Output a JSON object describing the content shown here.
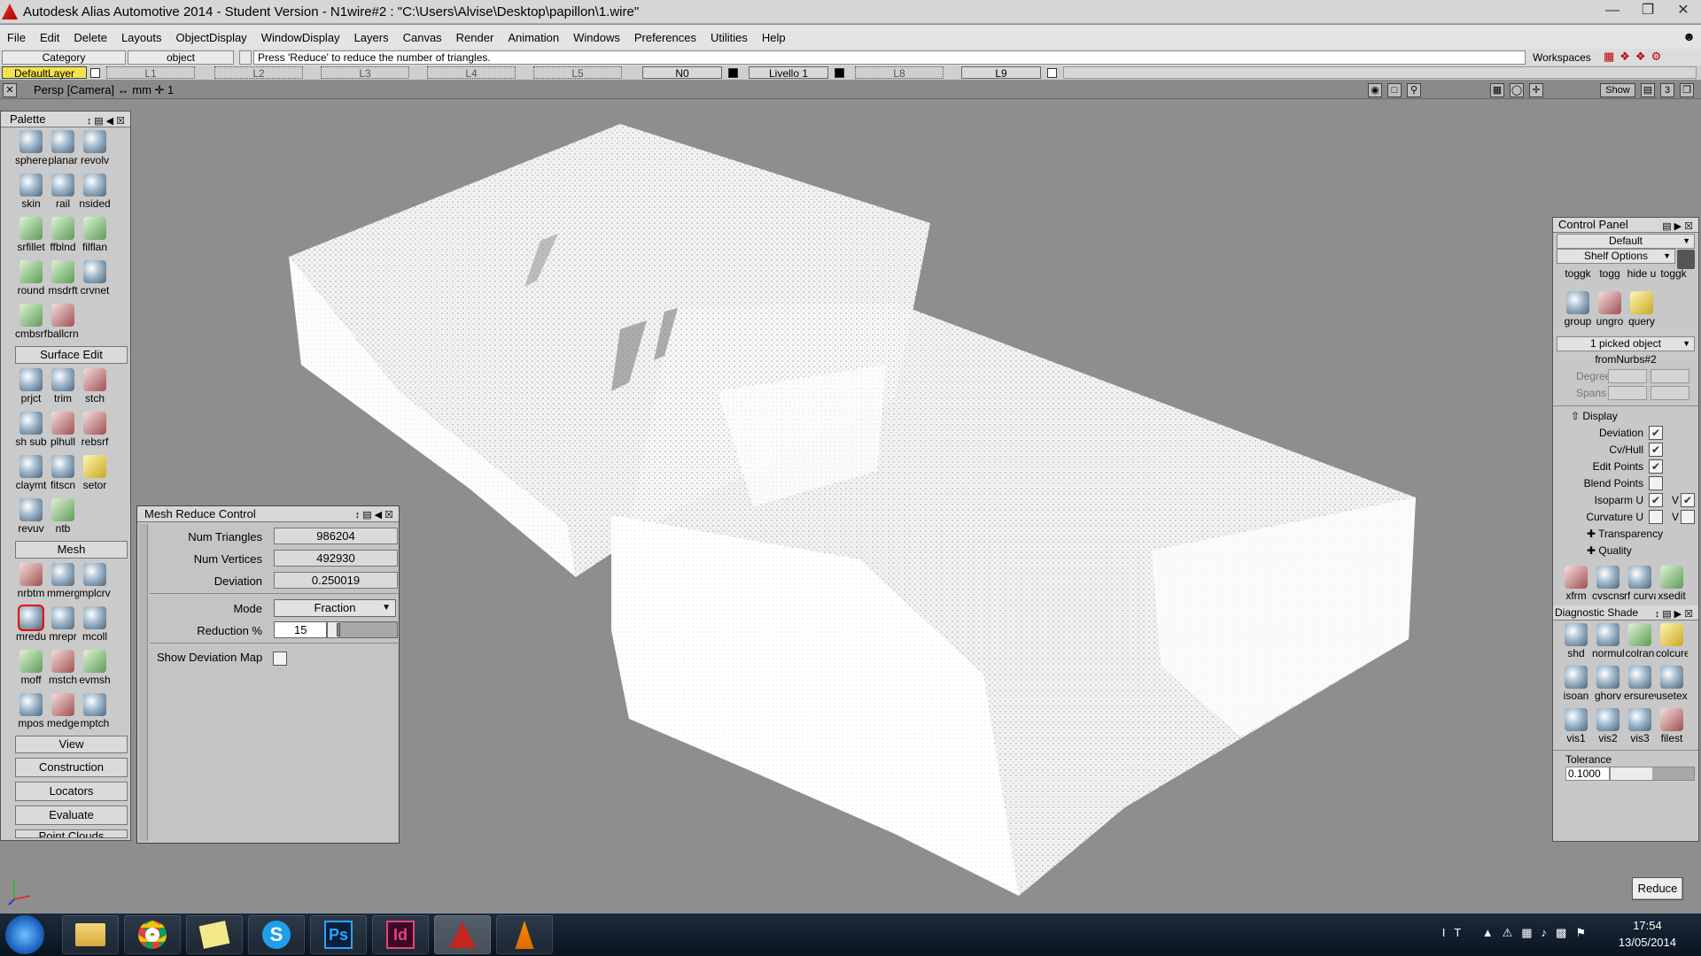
{
  "window": {
    "title": "Autodesk Alias Automotive 2014   - Student Version   - N1wire#2 : \"C:\\Users\\Alvise\\Desktop\\papillon\\1.wire\""
  },
  "menu": [
    "File",
    "Edit",
    "Delete",
    "Layouts",
    "ObjectDisplay",
    "WindowDisplay",
    "Layers",
    "Canvas",
    "Render",
    "Animation",
    "Windows",
    "Preferences",
    "Utilities",
    "Help"
  ],
  "infobar": {
    "category": "Category",
    "object": "object",
    "prompt": "Press 'Reduce' to reduce the number of triangles.",
    "workspaces": "Workspaces"
  },
  "layers": {
    "default": "DefaultLayer",
    "items": [
      "L1",
      "L2",
      "L3",
      "L4",
      "L5"
    ],
    "n0": "N0",
    "livello": "Livello 1",
    "l8": "L8",
    "l9": "L9"
  },
  "viewbar": {
    "label": "Persp [Camera] ↔ mm   ✛ 1",
    "show": "Show",
    "num": "3"
  },
  "palette": {
    "title": "Palette",
    "group1": [
      "sphere",
      "planar",
      "revolv",
      "skin",
      "rail",
      "nsided",
      "srfillet",
      "ffblnd",
      "filflan",
      "round",
      "msdrft",
      "crvnet",
      "cmbsrf",
      "ballcrn"
    ],
    "surface_edit": "Surface Edit",
    "group2": [
      "prjct",
      "trim",
      "stch",
      "sh sub",
      "plhull",
      "rebsrf",
      "claymt",
      "fitscn",
      "setor",
      "revuv",
      "ntb"
    ],
    "mesh": "Mesh",
    "group3": [
      "nrbtm",
      "mmerg",
      "mplcrv",
      "mredu",
      "mrepr",
      "mcoll",
      "moff",
      "mstch",
      "evmsh",
      "mpos",
      "medge",
      "mptch"
    ],
    "sections": [
      "View",
      "Construction",
      "Locators",
      "Evaluate",
      "Point Clouds"
    ]
  },
  "mesh_reduce": {
    "title": "Mesh Reduce Control",
    "num_triangles_label": "Num Triangles",
    "num_triangles": "986204",
    "num_vertices_label": "Num Vertices",
    "num_vertices": "492930",
    "deviation_label": "Deviation",
    "deviation": "0.250019",
    "mode_label": "Mode",
    "mode": "Fraction",
    "reduction_label": "Reduction %",
    "reduction": "15",
    "reduction_fraction": 0.15,
    "show_deviation_map": "Show Deviation Map"
  },
  "control_panel": {
    "title": "Control Panel",
    "preset": "Default",
    "shelf_options": "Shelf Options",
    "shelf_row1": [
      "toggk",
      "togg",
      "hide u",
      "toggk"
    ],
    "shelf_row2": [
      "group",
      "ungro",
      "query"
    ],
    "picked": "1 picked object",
    "object_name": "fromNurbs#2",
    "degree": "Degree",
    "spans": "Spans",
    "display": "Display",
    "checks": [
      {
        "label": "Deviation",
        "on": true
      },
      {
        "label": "Cv/Hull",
        "on": true
      },
      {
        "label": "Edit Points",
        "on": true
      },
      {
        "label": "Blend Points",
        "on": false
      },
      {
        "label": "Isoparm U",
        "on": true
      },
      {
        "label": "Curvature U",
        "on": false
      }
    ],
    "v_label": "V",
    "transparency": "Transparency",
    "quality": "Quality",
    "shelf_row3": [
      "xfrm",
      "cvscns",
      "rf curva",
      "xsedit"
    ],
    "diag_title": "Diagnostic Shade",
    "diag_row1": [
      "shd",
      "normul",
      "colran",
      "colcurevl"
    ],
    "diag_row2": [
      "isoan",
      "ghorv",
      "ersurevl",
      "usetex"
    ],
    "diag_row3": [
      "vis1",
      "vis2",
      "vis3",
      "filest"
    ],
    "tolerance_label": "Tolerance",
    "tolerance": "0.1000"
  },
  "reduce_button": "Reduce",
  "taskbar": {
    "apps": [
      "explorer",
      "chrome",
      "notes",
      "skype",
      "Ps",
      "Id",
      "alias",
      "vlc"
    ],
    "lang": "IT",
    "time": "17:54",
    "date": "13/05/2014"
  },
  "icons": [
    "windows-start-icon",
    "folder-icon",
    "chrome-icon",
    "notes-icon",
    "skype-icon",
    "photoshop-icon",
    "indesign-icon",
    "alias-icon",
    "vlc-icon",
    "view-cube-icon",
    "axis-triad-icon"
  ]
}
